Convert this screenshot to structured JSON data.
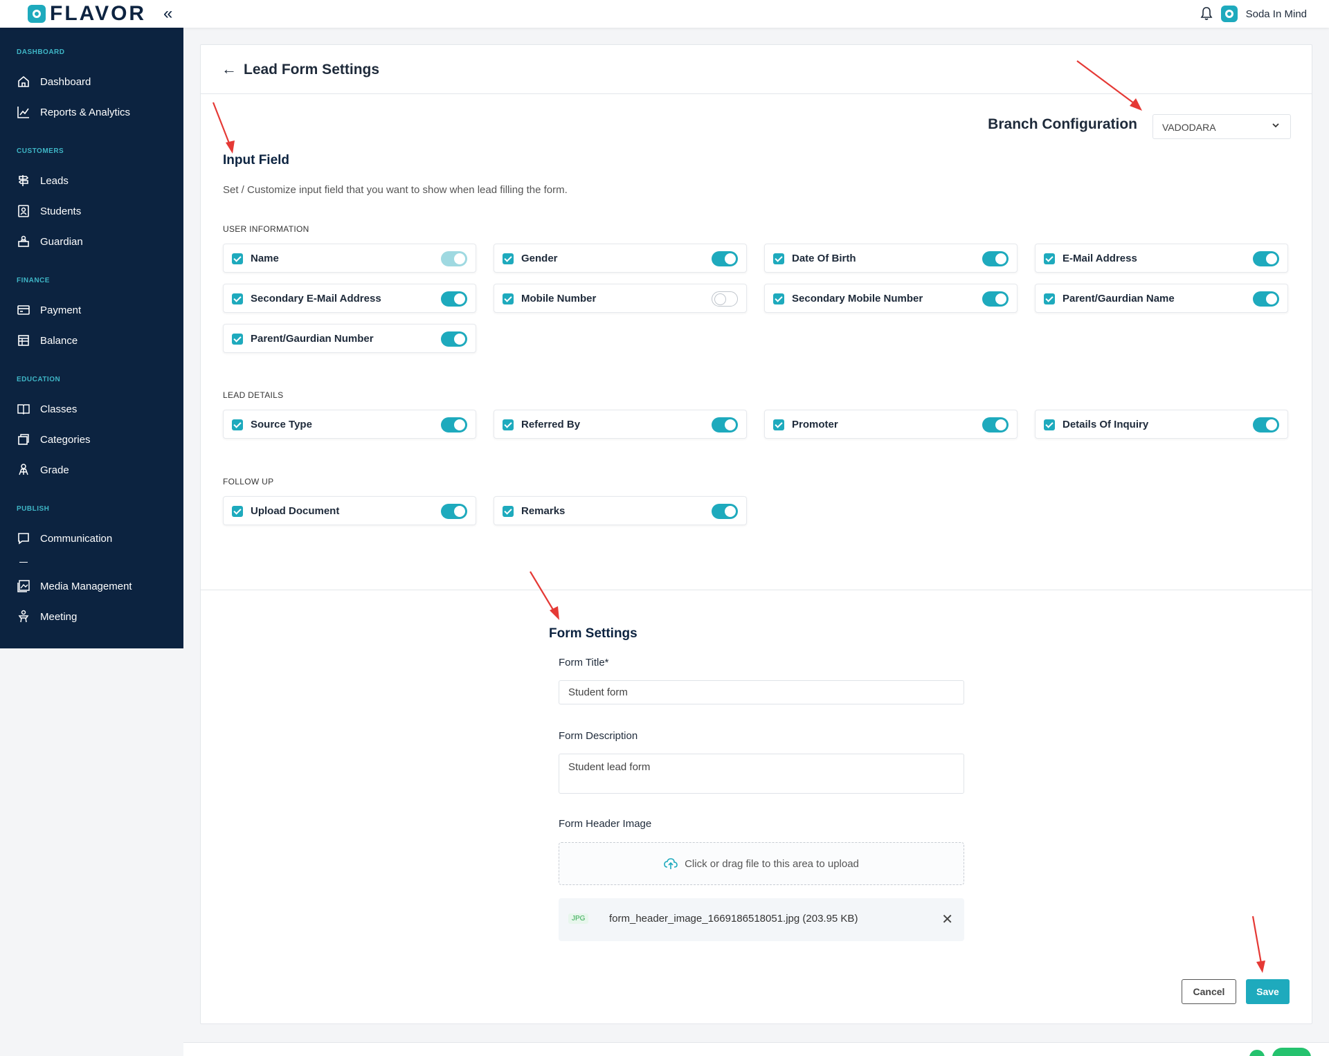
{
  "header": {
    "brand": "FLAVOR",
    "user_name": "Soda In Mind"
  },
  "sidebar": {
    "sections": [
      {
        "title": "DASHBOARD",
        "items": [
          {
            "label": "Dashboard",
            "icon": "home-icon"
          },
          {
            "label": "Reports & Analytics",
            "icon": "chart-line-icon"
          }
        ]
      },
      {
        "title": "CUSTOMERS",
        "items": [
          {
            "label": "Leads",
            "icon": "signpost-icon"
          },
          {
            "label": "Students",
            "icon": "student-card-icon"
          },
          {
            "label": "Guardian",
            "icon": "guardian-icon"
          }
        ]
      },
      {
        "title": "FINANCE",
        "items": [
          {
            "label": "Payment",
            "icon": "card-icon"
          },
          {
            "label": "Balance",
            "icon": "ledger-icon"
          }
        ]
      },
      {
        "title": "EDUCATION",
        "items": [
          {
            "label": "Classes",
            "icon": "book-icon"
          },
          {
            "label": "Categories",
            "icon": "stack-icon"
          },
          {
            "label": "Grade",
            "icon": "grade-icon"
          }
        ]
      },
      {
        "title": "PUBLISH",
        "items": [
          {
            "label": "Communication",
            "icon": "message-icon"
          },
          {
            "label": "Media Management",
            "icon": "image-icon"
          },
          {
            "label": "Meeting",
            "icon": "meeting-icon"
          }
        ]
      }
    ]
  },
  "page": {
    "title": "Lead Form Settings",
    "branch_label": "Branch Configuration",
    "branch_value": "VADODARA",
    "input_field_title": "Input Field",
    "input_field_desc": "Set / Customize input field that you want to show when lead filling the form.",
    "groups": {
      "user_info": {
        "label": "USER INFORMATION",
        "fields": [
          {
            "label": "Name",
            "checked": true,
            "toggle": "on-disabled"
          },
          {
            "label": "Gender",
            "checked": true,
            "toggle": "on"
          },
          {
            "label": "Date Of Birth",
            "checked": true,
            "toggle": "on"
          },
          {
            "label": "E-Mail Address",
            "checked": true,
            "toggle": "on"
          },
          {
            "label": "Secondary E-Mail Address",
            "checked": true,
            "toggle": "on"
          },
          {
            "label": "Mobile Number",
            "checked": true,
            "toggle": "off"
          },
          {
            "label": "Secondary Mobile Number",
            "checked": true,
            "toggle": "on"
          },
          {
            "label": "Parent/Gaurdian Name",
            "checked": true,
            "toggle": "on"
          },
          {
            "label": "Parent/Gaurdian Number",
            "checked": true,
            "toggle": "on"
          }
        ]
      },
      "lead_details": {
        "label": "LEAD DETAILS",
        "fields": [
          {
            "label": "Source Type",
            "checked": true,
            "toggle": "on"
          },
          {
            "label": "Referred By",
            "checked": true,
            "toggle": "on"
          },
          {
            "label": "Promoter",
            "checked": true,
            "toggle": "on"
          },
          {
            "label": "Details Of Inquiry",
            "checked": true,
            "toggle": "on"
          }
        ]
      },
      "follow_up": {
        "label": "FOLLOW UP",
        "fields": [
          {
            "label": "Upload Document",
            "checked": true,
            "toggle": "on"
          },
          {
            "label": "Remarks",
            "checked": true,
            "toggle": "on"
          }
        ]
      }
    },
    "form_settings": {
      "title": "Form Settings",
      "form_title_label": "Form Title*",
      "form_title_value": "Student form",
      "form_desc_label": "Form Description",
      "form_desc_value": "Student lead form",
      "header_image_label": "Form Header Image",
      "upload_text": "Click or drag file to this area to upload",
      "file_badge": "JPG",
      "file_name": "form_header_image_1669186518051.jpg (203.95 KB)"
    },
    "buttons": {
      "cancel": "Cancel",
      "save": "Save"
    }
  },
  "colors": {
    "accent": "#1eaabd",
    "sidebar_bg": "#0c2340",
    "arrow": "#e53935"
  }
}
